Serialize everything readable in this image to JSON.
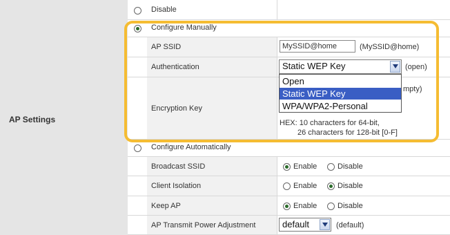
{
  "section_label": "AP Settings",
  "radios": {
    "disable": "Disable",
    "configure_manually": "Configure Manually",
    "configure_automatically": "Configure Automatically"
  },
  "fields": {
    "ap_ssid": {
      "label": "AP SSID",
      "value": "MySSID@home",
      "default": "(MySSID@home)"
    },
    "authentication": {
      "label": "Authentication",
      "selected": "Static WEP Key",
      "default": "(open)",
      "options": [
        "Open",
        "Static WEP Key",
        "WPA/WPA2-Personal"
      ]
    },
    "encryption_key": {
      "label": "Encryption Key",
      "peek_text": "mpty)",
      "hint_line1": "HEX: 10 characters for 64-bit,",
      "hint_line2": "26 characters for 128-bit [0-F]"
    },
    "broadcast_ssid": {
      "label": "Broadcast SSID",
      "enable": "Enable",
      "disable": "Disable",
      "selected": "enable"
    },
    "client_isolation": {
      "label": "Client Isolation",
      "enable": "Enable",
      "disable": "Disable",
      "selected": "disable"
    },
    "keep_ap": {
      "label": "Keep AP",
      "enable": "Enable",
      "disable": "Disable",
      "selected": "enable"
    },
    "transmit_power": {
      "label": "AP Transmit Power Adjustment",
      "selected": "default",
      "default": "(default)"
    }
  },
  "colors": {
    "highlight": "#f5bc32",
    "selected_option": "#3a5ec4",
    "label_column": "#f1f1f1",
    "section_column": "#e5e5e5"
  }
}
